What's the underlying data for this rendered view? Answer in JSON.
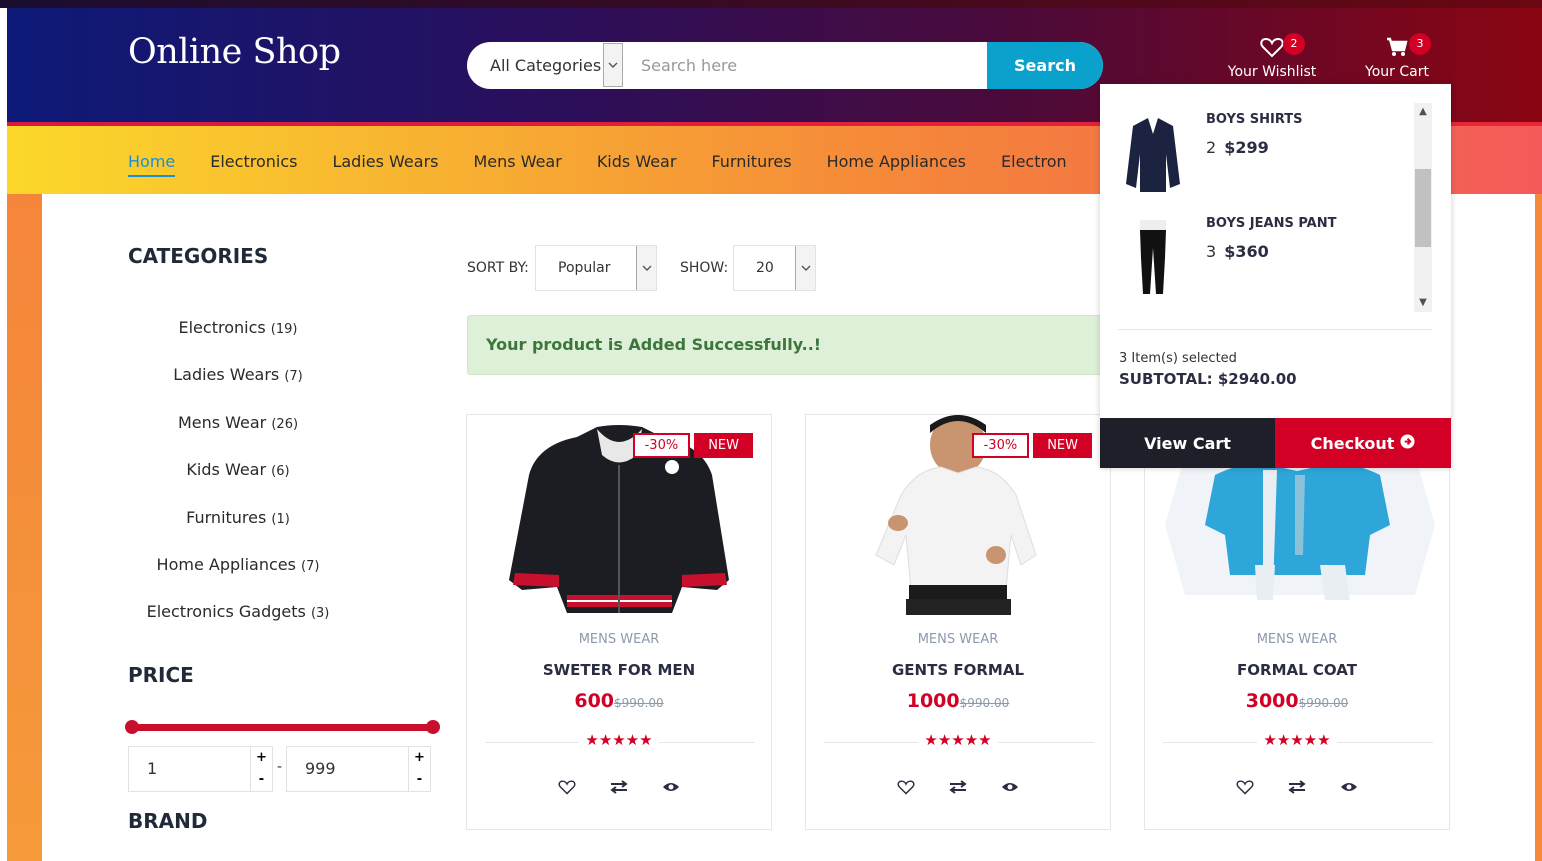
{
  "header": {
    "logo": "Online Shop",
    "category_select": "All Categories",
    "search_placeholder": "Search here",
    "search_button": "Search",
    "wishlist_label": "Your Wishlist",
    "wishlist_count": "2",
    "cart_label": "Your Cart",
    "cart_count": "3"
  },
  "nav": {
    "items": [
      {
        "label": "Home",
        "active": true
      },
      {
        "label": "Electronics"
      },
      {
        "label": "Ladies Wears"
      },
      {
        "label": "Mens Wear"
      },
      {
        "label": "Kids Wear"
      },
      {
        "label": "Furnitures"
      },
      {
        "label": "Home Appliances"
      },
      {
        "label": "Electron"
      }
    ]
  },
  "sidebar": {
    "categories_title": "CATEGORIES",
    "categories": [
      {
        "label": "Electronics",
        "count": "(19)"
      },
      {
        "label": "Ladies Wears",
        "count": "(7)"
      },
      {
        "label": "Mens Wear",
        "count": "(26)"
      },
      {
        "label": "Kids Wear",
        "count": "(6)"
      },
      {
        "label": "Furnitures",
        "count": "(1)"
      },
      {
        "label": "Home Appliances",
        "count": "(7)"
      },
      {
        "label": "Electronics Gadgets",
        "count": "(3)"
      }
    ],
    "price_title": "PRICE",
    "price_min": "1",
    "price_max": "999",
    "price_plus": "+",
    "price_minus": "-",
    "price_dash": "-",
    "brand_title": "BRAND"
  },
  "toolbar": {
    "sort_label": "SORT BY:",
    "sort_value": "Popular",
    "show_label": "SHOW:",
    "show_value": "20"
  },
  "alert": "Your product is Added Successfully..!",
  "products": [
    {
      "sale": "-30%",
      "new": "NEW",
      "category": "MENS WEAR",
      "name": "SWETER FOR MEN",
      "price": "600",
      "old_price": "$990.00",
      "rating": 5
    },
    {
      "sale": "-30%",
      "new": "NEW",
      "category": "MENS WEAR",
      "name": "GENTS FORMAL",
      "price": "1000",
      "old_price": "$990.00",
      "rating": 5
    },
    {
      "category": "MENS WEAR",
      "name": "FORMAL COAT",
      "price": "3000",
      "old_price": "$990.00",
      "rating": 5
    }
  ],
  "cart_dropdown": {
    "items": [
      {
        "title": "BOYS SHIRTS",
        "qty": "2",
        "price": "$299"
      },
      {
        "title": "BOYS JEANS PANT",
        "qty": "3",
        "price": "$360"
      }
    ],
    "selected": "3 Item(s) selected",
    "subtotal": "SUBTOTAL: $2940.00",
    "view_cart": "View Cart",
    "checkout": "Checkout"
  },
  "colors": {
    "brand_red": "#d10024",
    "search_blue": "#0aa2cc",
    "success_green": "#3c763d",
    "nav_active": "#1a8fd6"
  },
  "icons": [
    "heart-icon",
    "cart-icon",
    "chevron-down-icon",
    "compare-icon",
    "eye-icon",
    "star-icon",
    "arrow-circle-right-icon"
  ]
}
